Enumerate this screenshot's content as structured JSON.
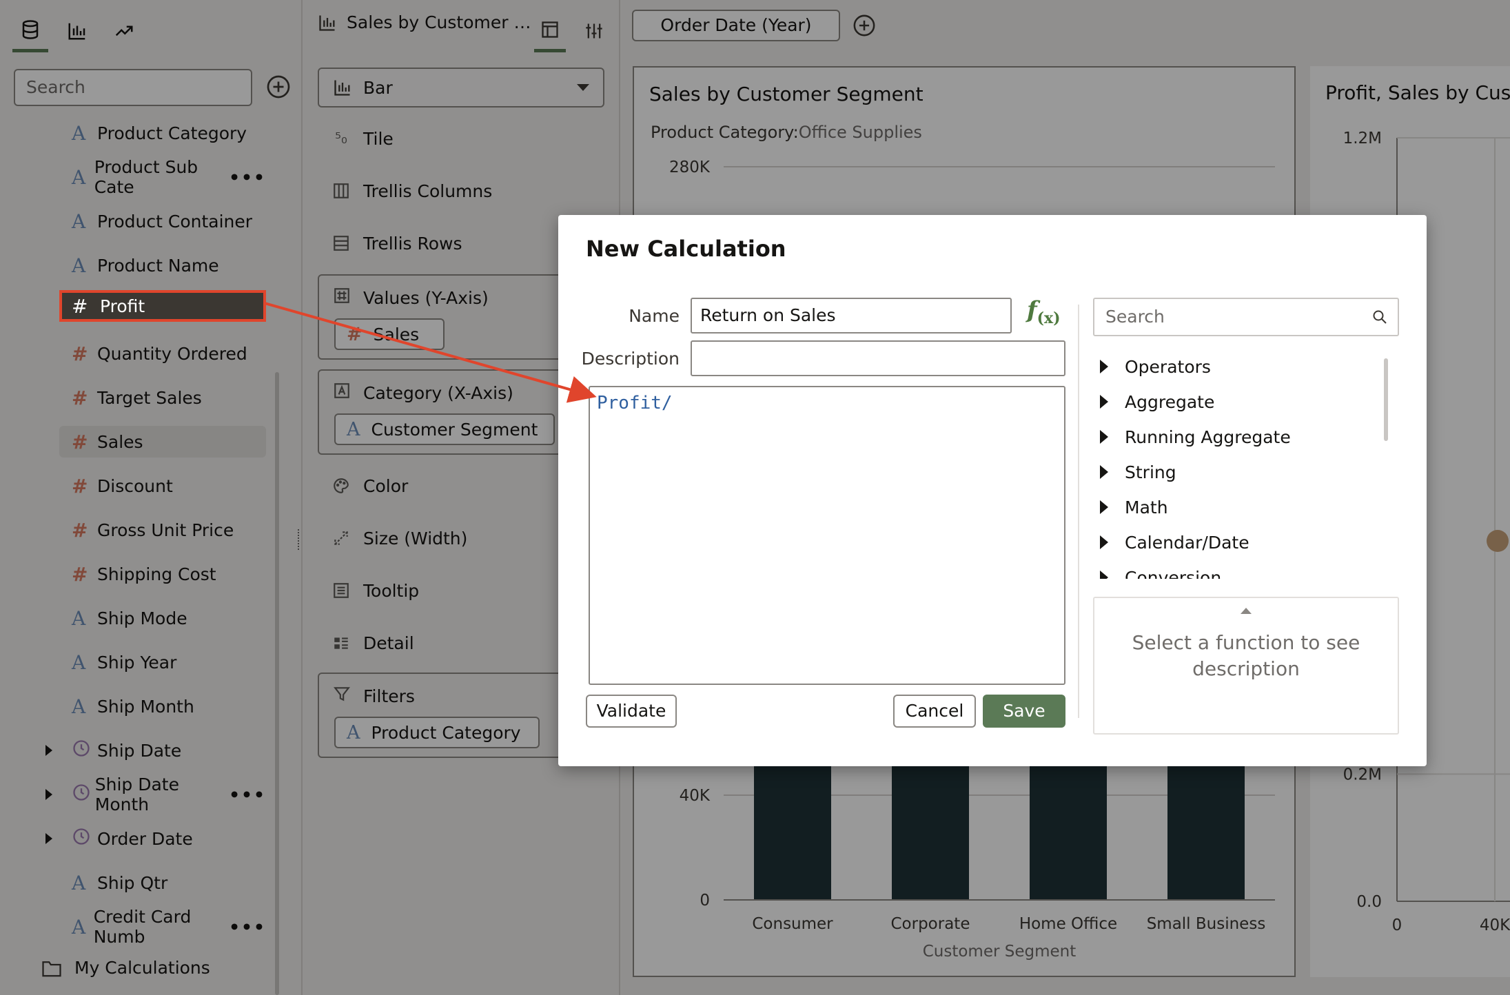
{
  "left_panel": {
    "search_placeholder": "Search",
    "fields": [
      {
        "type": "attribute",
        "label": "Product Category"
      },
      {
        "type": "attribute",
        "label": "Product Sub Cate",
        "truncated": true
      },
      {
        "type": "attribute",
        "label": "Product Container"
      },
      {
        "type": "attribute",
        "label": "Product Name"
      },
      {
        "type": "measure",
        "label": "Profit",
        "state": "dragging"
      },
      {
        "type": "measure",
        "label": "Quantity Ordered"
      },
      {
        "type": "measure",
        "label": "Target Sales"
      },
      {
        "type": "measure",
        "label": "Sales",
        "state": "highlighted"
      },
      {
        "type": "measure",
        "label": "Discount"
      },
      {
        "type": "measure",
        "label": "Gross Unit Price"
      },
      {
        "type": "measure",
        "label": "Shipping Cost"
      },
      {
        "type": "attribute",
        "label": "Ship Mode"
      },
      {
        "type": "attribute",
        "label": "Ship Year"
      },
      {
        "type": "attribute",
        "label": "Ship Month"
      },
      {
        "type": "time",
        "label": "Ship Date",
        "expandable": true
      },
      {
        "type": "time",
        "label": "Ship Date Month",
        "expandable": true,
        "truncated": true
      },
      {
        "type": "time",
        "label": "Order Date",
        "expandable": true
      },
      {
        "type": "attribute",
        "label": "Ship Qtr"
      },
      {
        "type": "attribute",
        "label": "Credit Card Numb",
        "truncated": true
      }
    ],
    "folder_label": "My Calculations",
    "more_glyph": "•••"
  },
  "grammar": {
    "viz_title": "Sales by Customer …",
    "chart_type": "Bar",
    "rows": {
      "tile": "Tile",
      "trellis_columns": "Trellis Columns",
      "trellis_rows": "Trellis Rows",
      "color": "Color",
      "size": "Size (Width)",
      "tooltip": "Tooltip",
      "detail": "Detail"
    },
    "values_label": "Values (Y-Axis)",
    "values_pill": "Sales",
    "category_label": "Category (X-Axis)",
    "category_pill": "Customer Segment",
    "filters_label": "Filters",
    "filters_pill": "Product Category"
  },
  "canvas": {
    "order_chip": "Order Date (Year)",
    "viz1": {
      "title": "Sales by Customer Segment",
      "filter_label": "Product Category:",
      "filter_value": "Office Supplies"
    },
    "viz2": {
      "title": "Profit, Sales by Custo"
    }
  },
  "dialog": {
    "title": "New Calculation",
    "name_label": "Name",
    "name_value": "Return on Sales",
    "fx_label": "f",
    "fx_sub": "(x)",
    "description_label": "Description",
    "description_value": "",
    "expression": "Profit/",
    "validate_label": "Validate",
    "cancel_label": "Cancel",
    "save_label": "Save",
    "function_search_placeholder": "Search",
    "function_categories": [
      "Operators",
      "Aggregate",
      "Running Aggregate",
      "String",
      "Math",
      "Calendar/Date",
      "Conversion"
    ],
    "function_description": "Select a function to see description"
  },
  "colors": {
    "accent": "#5b7a56",
    "drag_outline": "#e0452c",
    "bar": "#1f3338",
    "attribute_icon": "#6b8cb8",
    "measure_icon": "#d87a62"
  },
  "chart_data": [
    {
      "type": "bar",
      "title": "Sales by Customer Segment",
      "categories": [
        "Consumer",
        "Corporate",
        "Home Office",
        "Small Business"
      ],
      "xlabel": "Customer Segment",
      "ylabel": "",
      "y_ticks": [
        "0",
        "40K",
        "280K"
      ],
      "ylim": [
        0,
        280000
      ],
      "series": [
        {
          "values": [
            116000,
            116000,
            116000,
            116000
          ]
        }
      ],
      "grid": true,
      "note": "bar tops are hidden behind the dialog"
    },
    {
      "type": "scatter",
      "title": "Profit, Sales by Custo",
      "y_ticks": [
        "0.0",
        "0.2M",
        "1.2M"
      ],
      "x_ticks": [
        "0",
        "40K"
      ],
      "ylim": [
        0,
        1200000
      ],
      "grid": true
    }
  ]
}
